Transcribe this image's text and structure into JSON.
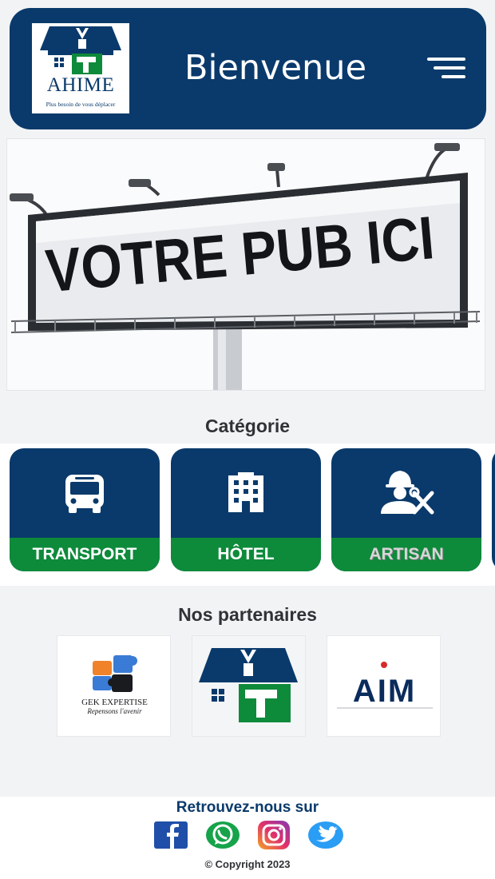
{
  "header": {
    "title": "Bienvenue",
    "logo_text": "AHIME",
    "logo_slogan": "Plus besoin de vous déplacer",
    "background": "#0a3a6b"
  },
  "banner": {
    "text": "VOTRE PUB ICI"
  },
  "categories": {
    "title": "Catégorie",
    "items": [
      {
        "label": "TRANSPORT",
        "icon": "bus-icon"
      },
      {
        "label": "HÔTEL",
        "icon": "building-icon"
      },
      {
        "label": "ARTISAN",
        "icon": "worker-icon"
      }
    ],
    "label_color": "#0e8a3b"
  },
  "partners": {
    "title": "Nos partenaires",
    "items": [
      {
        "name": "GEK EXPERTISE",
        "tagline": "Repensons l'avenir",
        "icon": "puzzle-logo"
      },
      {
        "name": "AHIME",
        "icon": "house-tools-logo"
      },
      {
        "name": "AIM",
        "icon": "aim-logo"
      }
    ]
  },
  "footer": {
    "title": "Retrouvez-nous sur",
    "socials": [
      "facebook-icon",
      "whatsapp-icon",
      "instagram-icon",
      "twitter-icon"
    ],
    "copyright": "© Copyright 2023"
  }
}
